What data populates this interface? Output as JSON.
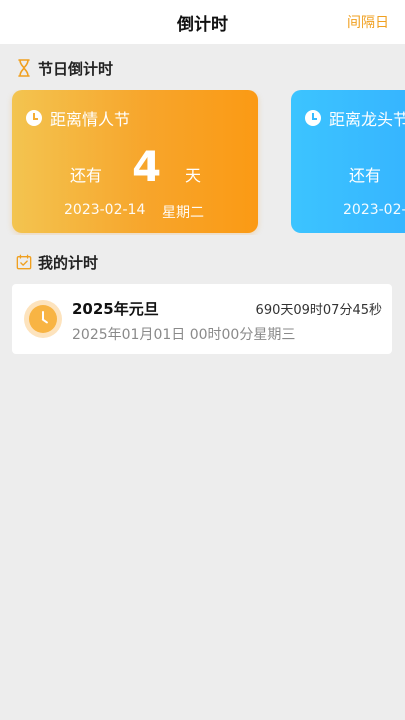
{
  "header": {
    "title": "倒计时",
    "action_label": "间隔日"
  },
  "holiday_section": {
    "title": "节日倒计时",
    "icon": "hourglass-icon",
    "cards": [
      {
        "name": "距离情人节",
        "remain_label": "还有",
        "days": "4",
        "days_unit": "天",
        "date": "2023-02-14",
        "weekday": "星期二",
        "color": "#f7a52b"
      },
      {
        "name": "距离龙头节",
        "remain_label": "还有",
        "date": "2023-02-",
        "color": "#35b2ff"
      }
    ]
  },
  "my_timers": {
    "title": "我的计时",
    "icon": "calendar-check-icon",
    "items": [
      {
        "title": "2025年元旦",
        "remaining": "690天09时07分45秒",
        "date": "2025年01月01日 00时00分星期三",
        "icon": "clock-icon"
      }
    ]
  }
}
